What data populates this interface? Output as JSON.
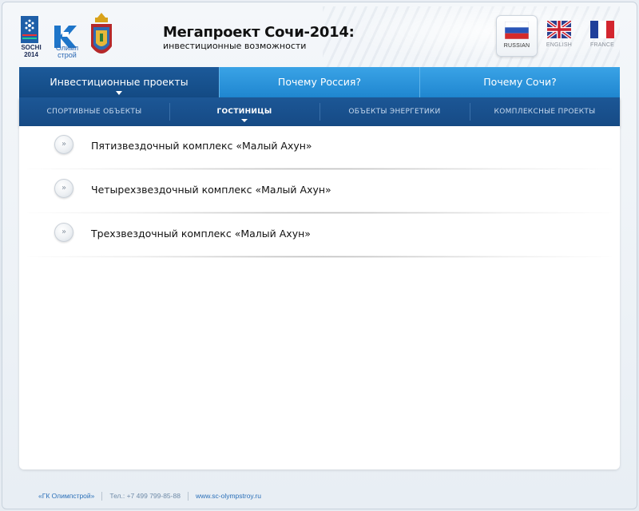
{
  "header": {
    "title": "Мегапроект Сочи-2014:",
    "subtitle": "инвестиционные возможности",
    "logos": {
      "sochi_text": "SOCHI\n2014",
      "olimp_text": "Олимп\nстрой"
    }
  },
  "languages": [
    {
      "label": "RUSSIAN",
      "active": true
    },
    {
      "label": "ENGLISH",
      "active": false
    },
    {
      "label": "FRANCE",
      "active": false
    }
  ],
  "nav": {
    "tabs": [
      {
        "label": "Инвестиционные проекты",
        "active": true
      },
      {
        "label": "Почему Россия?",
        "active": false
      },
      {
        "label": "Почему Сочи?",
        "active": false
      }
    ]
  },
  "subnav": {
    "items": [
      {
        "label": "СПОРТИВНЫЕ ОБЪЕКТЫ",
        "active": false
      },
      {
        "label": "ГОСТИНИЦЫ",
        "active": true
      },
      {
        "label": "ОБЪЕКТЫ ЭНЕРГЕТИКИ",
        "active": false
      },
      {
        "label": "КОМПЛЕКСНЫЕ ПРОЕКТЫ",
        "active": false
      }
    ]
  },
  "list": {
    "arrow_glyph": "»",
    "items": [
      {
        "label": "Пятизвездочный комплекс «Малый Ахун»"
      },
      {
        "label": "Четырехзвездочный комплекс «Малый Ахун»"
      },
      {
        "label": "Трехзвездочный комплекс «Малый Ахун»"
      }
    ]
  },
  "footer": {
    "company": "«ГК Олимпстрой»",
    "phone": "Тел.: +7 499 799-85-88",
    "website": "www.sc-olympstroy.ru"
  },
  "colors": {
    "nav_blue": "#1f86d0",
    "nav_active": "#134a84",
    "subnav_bg": "#164a85",
    "footer_link": "#2a6fb8"
  }
}
